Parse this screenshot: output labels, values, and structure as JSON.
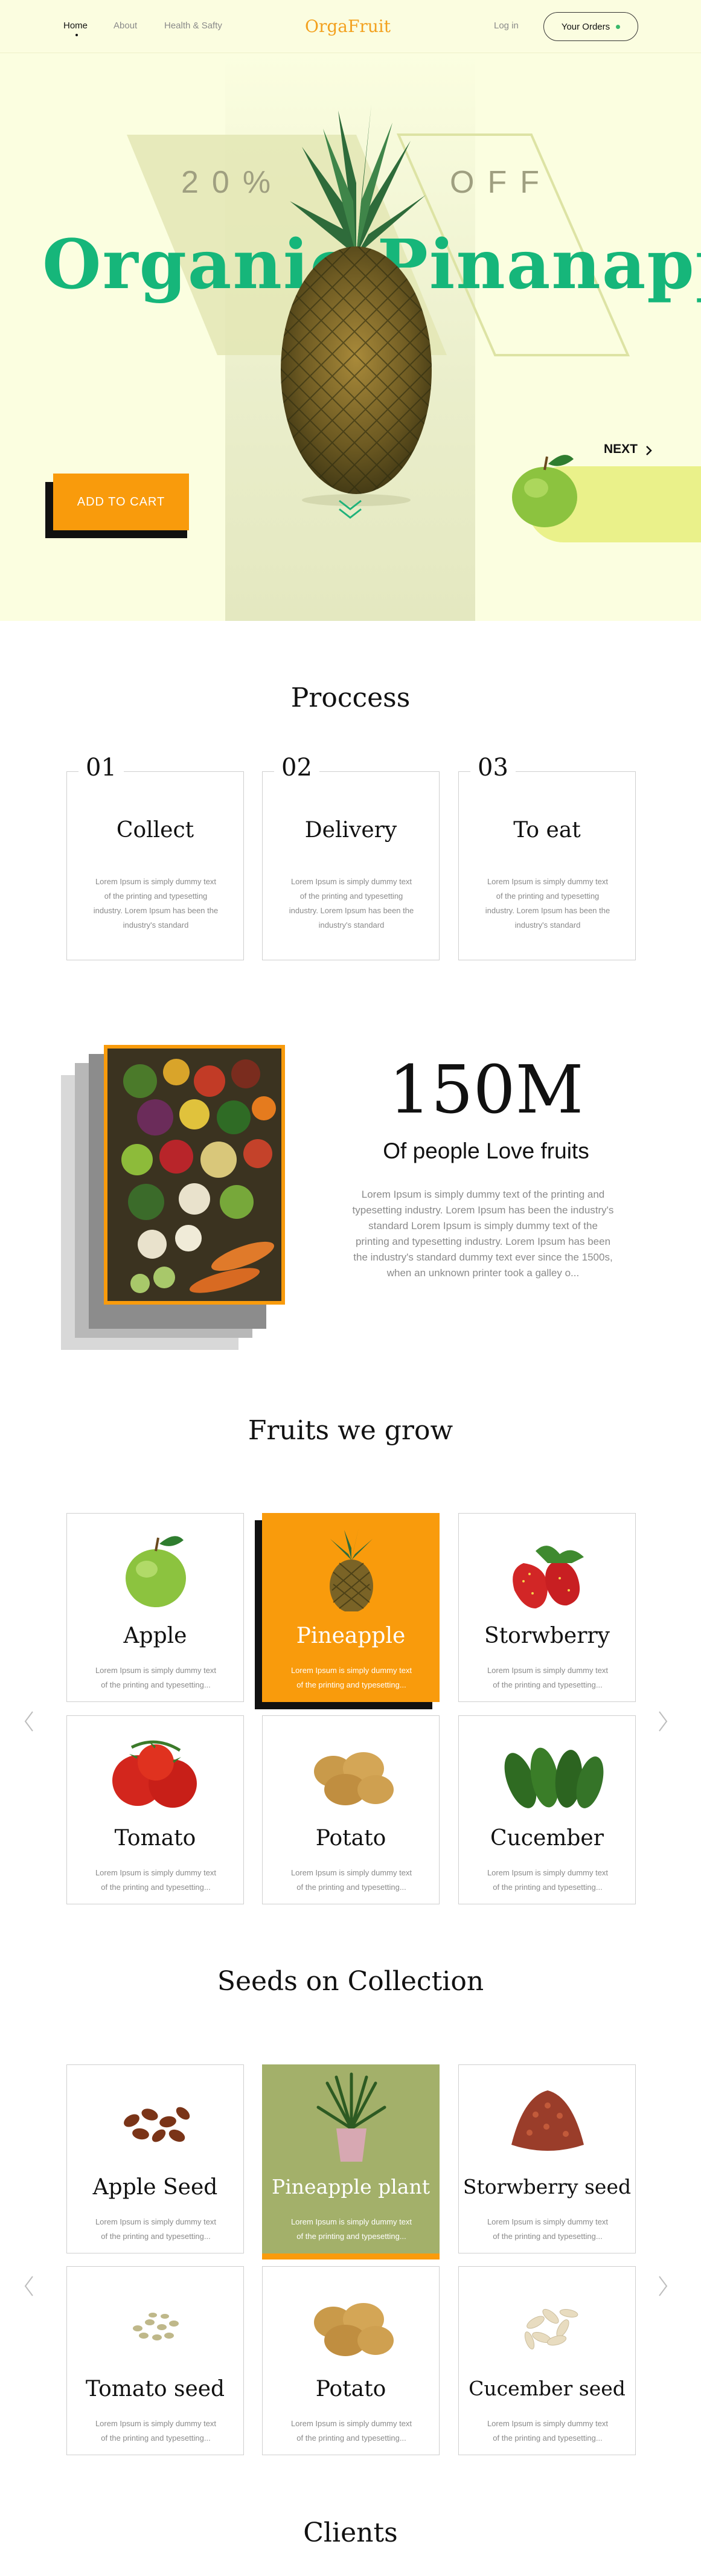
{
  "nav": {
    "links": [
      {
        "label": "Home",
        "active": true
      },
      {
        "label": "About",
        "active": false
      },
      {
        "label": "Health & Safty",
        "active": false
      }
    ],
    "logo": "OrgaFruit",
    "login": "Log in",
    "orders": "Your Orders"
  },
  "hero": {
    "discount_left": "20%",
    "discount_right": "OFF",
    "title": "Organic Pinanapple",
    "add_to_cart": "ADD TO CART",
    "next": "NEXT"
  },
  "process": {
    "title": "Proccess",
    "steps": [
      {
        "num": "01",
        "title": "Collect",
        "text": "Lorem Ipsum is simply dummy text of the printing and typesetting industry. Lorem Ipsum has been the industry's standard"
      },
      {
        "num": "02",
        "title": "Delivery",
        "text": "Lorem Ipsum is simply dummy text of the printing and typesetting industry. Lorem Ipsum has been the industry's standard"
      },
      {
        "num": "03",
        "title": "To eat",
        "text": "Lorem Ipsum is simply dummy text of the printing and typesetting industry. Lorem Ipsum has been the industry's standard"
      }
    ]
  },
  "stats": {
    "number": "150M",
    "subtitle": "Of people Love fruits",
    "text": "Lorem Ipsum is simply dummy text of the printing and typesetting industry. Lorem Ipsum has been the industry's standard Lorem Ipsum is simply dummy text of the printing and typesetting industry. Lorem Ipsum has been the industry's standard dummy text ever since the 1500s, when an unknown printer took a galley o..."
  },
  "fruits": {
    "title": "Fruits we grow",
    "items": [
      {
        "name": "Apple",
        "text": "Lorem Ipsum is simply dummy text of the printing and typesetting..."
      },
      {
        "name": "Pineapple",
        "text": "Lorem Ipsum is simply dummy text of the printing and typesetting...",
        "highlight": true
      },
      {
        "name": "Storwberry",
        "text": "Lorem Ipsum is simply dummy text of the printing and typesetting..."
      },
      {
        "name": "Tomato",
        "text": "Lorem Ipsum is simply dummy text of the printing and typesetting..."
      },
      {
        "name": "Potato",
        "text": "Lorem Ipsum is simply dummy text of the printing and typesetting..."
      },
      {
        "name": "Cucember",
        "text": "Lorem Ipsum is simply dummy text of the printing and typesetting..."
      }
    ]
  },
  "seeds": {
    "title": "Seeds on Collection",
    "items": [
      {
        "name": "Apple Seed",
        "text": "Lorem Ipsum is simply dummy text of the printing and typesetting..."
      },
      {
        "name": "Pineapple plant",
        "text": "Lorem Ipsum is simply dummy text of the printing and typesetting...",
        "highlight": true
      },
      {
        "name": "Storwberry seed",
        "text": "Lorem Ipsum is simply dummy text of the printing and typesetting..."
      },
      {
        "name": "Tomato seed",
        "text": "Lorem Ipsum is simply dummy text of the printing and typesetting..."
      },
      {
        "name": "Potato",
        "text": "Lorem Ipsum is simply dummy text of the printing and typesetting..."
      },
      {
        "name": "Cucember seed",
        "text": "Lorem Ipsum is simply dummy text of the printing and typesetting..."
      }
    ]
  },
  "clients": {
    "title": "Clients"
  },
  "colors": {
    "accent_orange": "#f99b0c",
    "brand_green": "#16b67a",
    "hero_bg": "#fbfee0",
    "olive": "#a3b06a"
  },
  "icons": [
    "chevron-down-icon",
    "chevron-right-icon",
    "chevron-left-icon",
    "status-dot-icon"
  ]
}
